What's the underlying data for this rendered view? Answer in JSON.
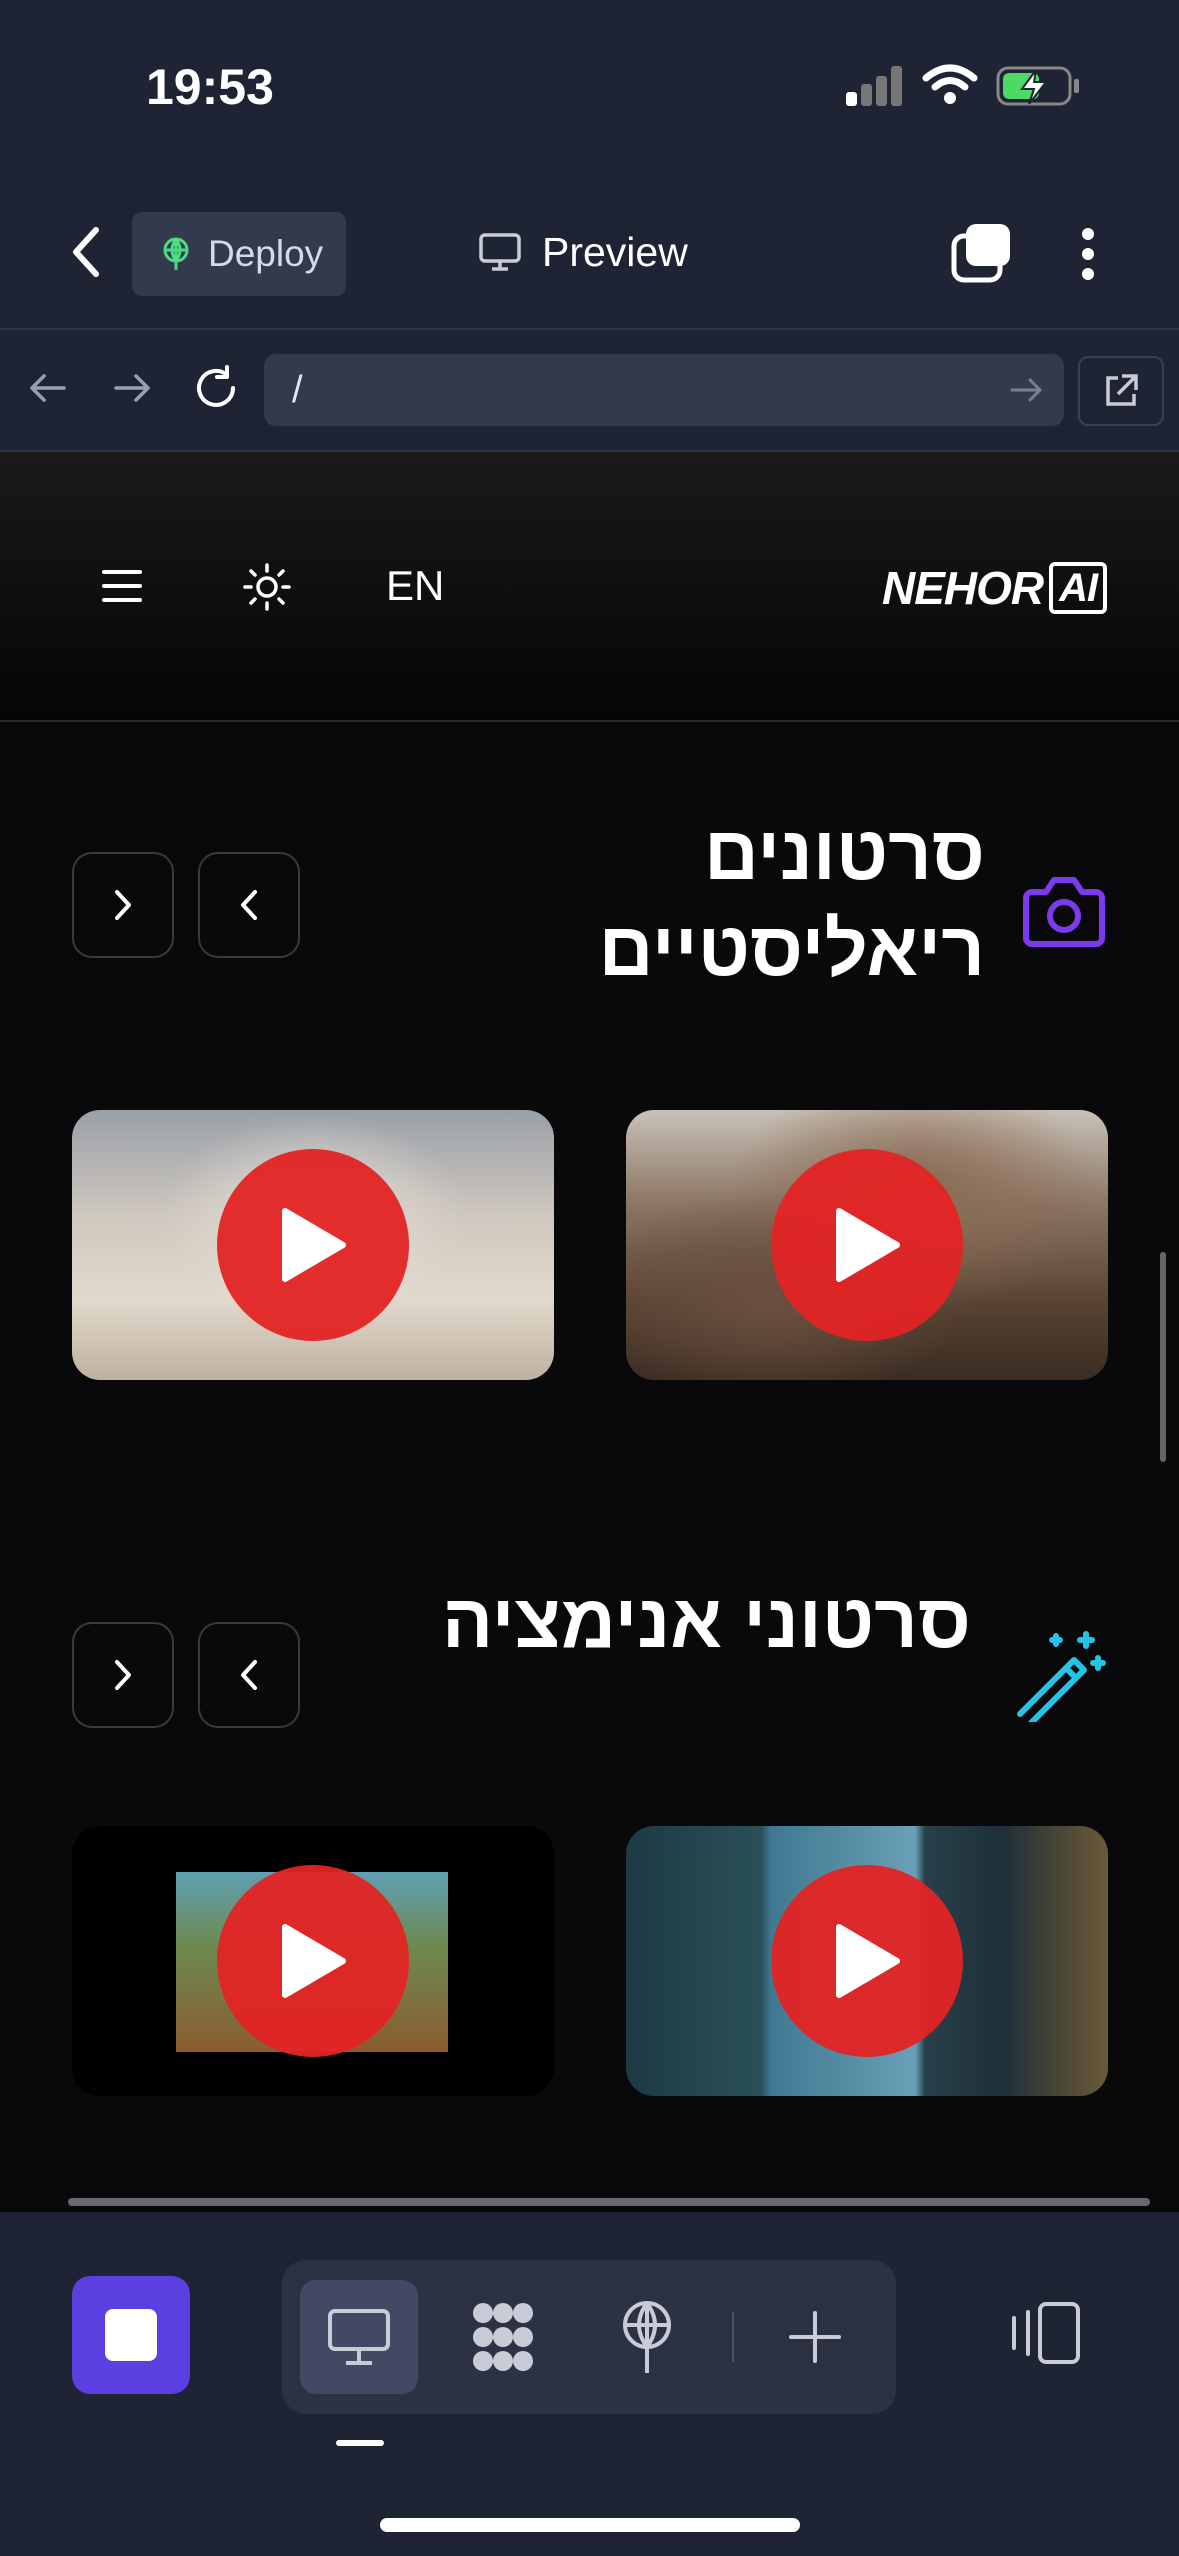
{
  "status": {
    "time": "19:53"
  },
  "toolbar": {
    "deploy_label": "Deploy",
    "preview_label": "Preview"
  },
  "urlbar": {
    "url": "/"
  },
  "site": {
    "lang_toggle": "EN",
    "logo_text": "NEHOR",
    "logo_badge": "AI",
    "sections": [
      {
        "title": "סרטונים ריאליסטיים",
        "icon": "camera-icon",
        "icon_color": "#7c3aed"
      },
      {
        "title": "סרטוני אנימציה",
        "icon": "magic-wand-icon",
        "icon_color": "#22c5e8"
      }
    ]
  },
  "colors": {
    "play_red": "#e32424",
    "whatsapp_green": "#25c75a",
    "stop_purple": "#5b3fe0"
  }
}
